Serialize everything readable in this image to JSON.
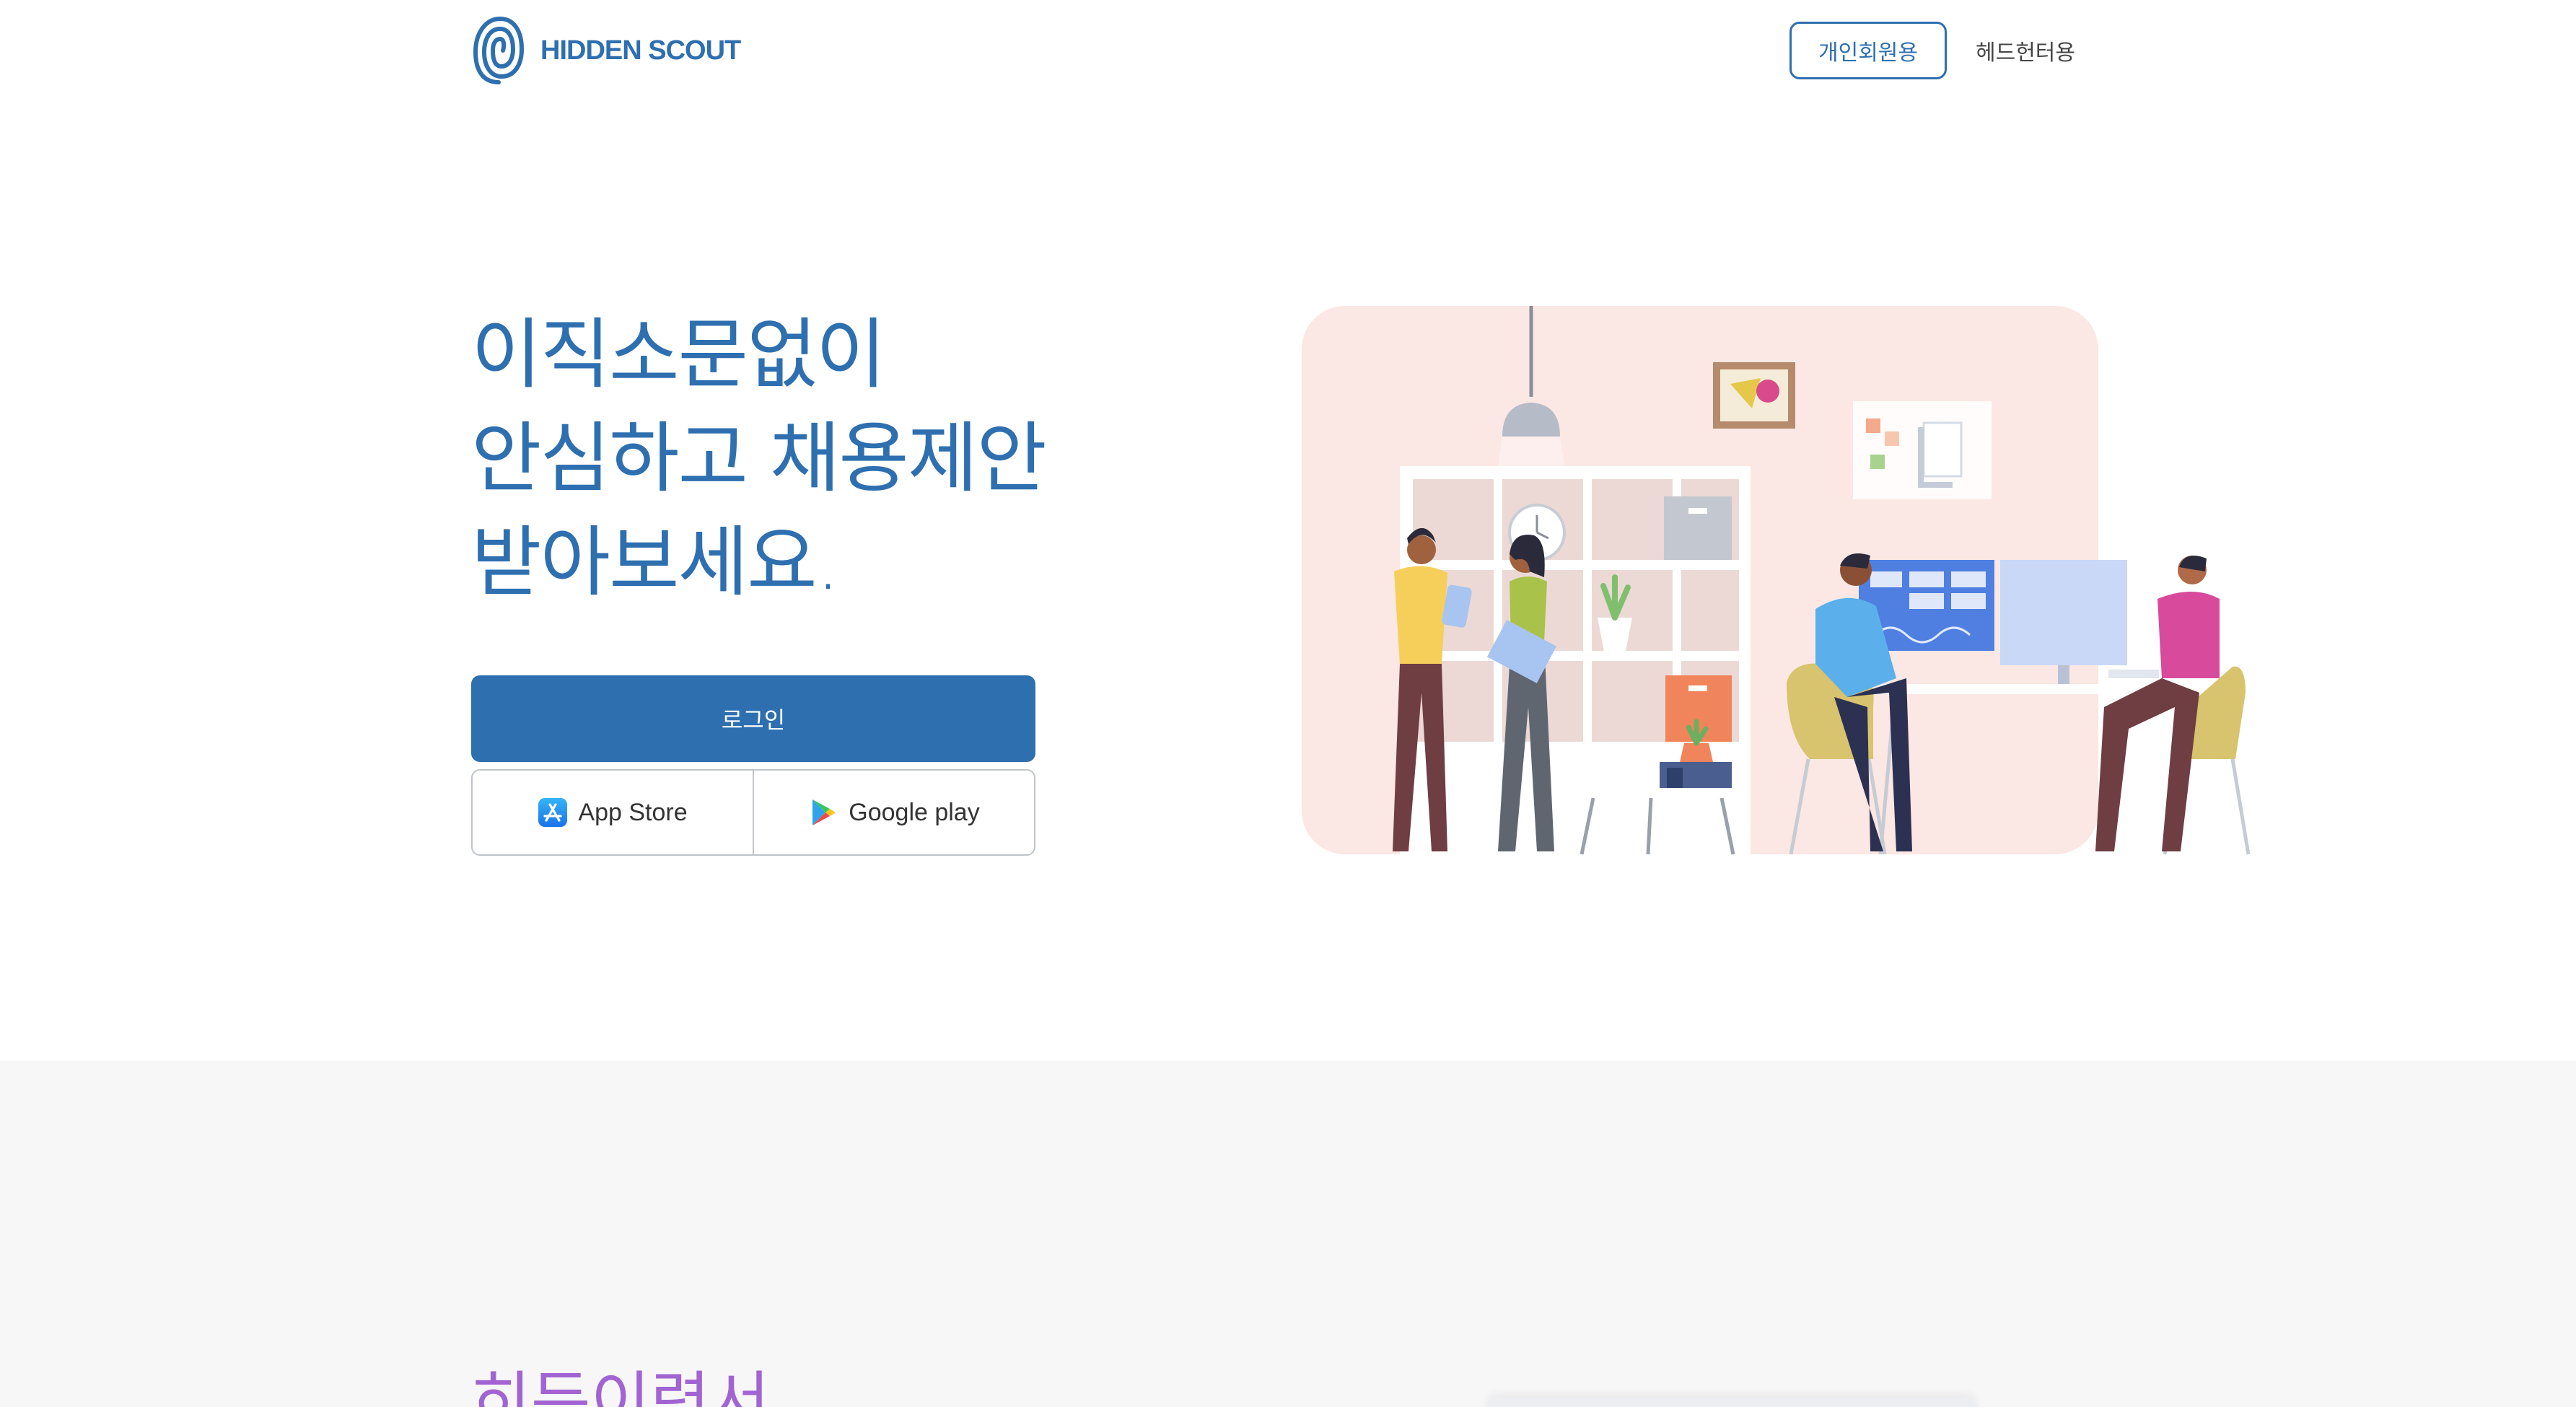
{
  "header": {
    "logo_text": "HIDDEN SCOUT",
    "logo_icon": "spiral-logo-icon",
    "nav": {
      "personal_label": "개인회원용",
      "headhunter_label": "헤드헌터용"
    }
  },
  "hero": {
    "title_lines": [
      "이직소문없이",
      "안심하고 채용제안",
      "받아보세요."
    ],
    "login_label": "로그인",
    "app_store_label": "App Store",
    "app_store_icon": "app-store-icon",
    "google_play_label": "Google play",
    "google_play_icon": "google-play-icon",
    "illustration_icon": "office-team-illustration"
  },
  "section2": {
    "title": "히든이력서"
  },
  "colors": {
    "brand_blue": "#2e6fb0",
    "accent_purple": "#a264d2",
    "illustration_bg": "#fbe7e3",
    "section_bg": "#f7f7f8"
  }
}
